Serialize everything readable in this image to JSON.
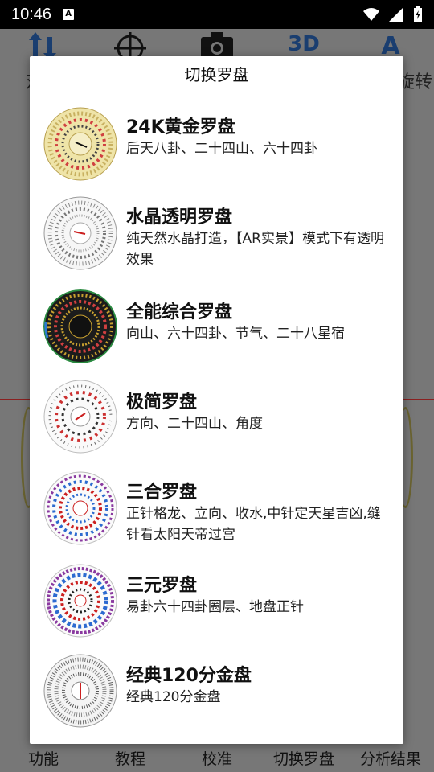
{
  "status": {
    "time": "10:46",
    "badge": "A"
  },
  "toolbar": {
    "labels_left": "对",
    "label_right": "旋转",
    "icon_3d": "3D",
    "icon_a": "A"
  },
  "bottom_nav": [
    "功能",
    "教程",
    "校准",
    "切换罗盘",
    "分析结果"
  ],
  "dialog": {
    "title": "切换罗盘",
    "items": [
      {
        "title": "24K黄金罗盘",
        "desc": "后天八卦、二十四山、六十四卦"
      },
      {
        "title": "水晶透明罗盘",
        "desc": "纯天然水晶打造，【AR实景】模式下有透明效果"
      },
      {
        "title": "全能综合罗盘",
        "desc": "向山、六十四卦、节气、二十八星宿"
      },
      {
        "title": "极简罗盘",
        "desc": "方向、二十四山、角度"
      },
      {
        "title": "三合罗盘",
        "desc": "正针格龙、立向、收水,中针定天星吉凶,缝针看太阳天帝过宫"
      },
      {
        "title": "三元罗盘",
        "desc": "易卦六十四卦圈层、地盘正针"
      },
      {
        "title": "经典120分金盘",
        "desc": "经典120分金盘"
      }
    ]
  },
  "colors": {
    "gold": "#e8dca0",
    "crystal": "#f4f4f4",
    "dark": "#1a1a1a",
    "accent_blue": "#2c5aa0",
    "accent_red": "#cc2020"
  }
}
